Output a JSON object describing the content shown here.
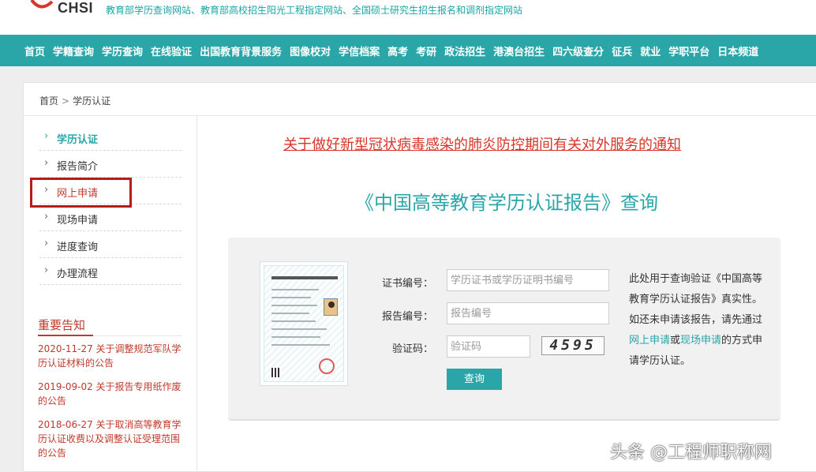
{
  "header": {
    "logo_text": "CHSI",
    "tagline": "教育部学历查询网站、教育部高校招生阳光工程指定网站、全国硕士研究生招生报名和调剂指定网站"
  },
  "nav": [
    "首页",
    "学籍查询",
    "学历查询",
    "在线验证",
    "出国教育背景服务",
    "图像校对",
    "学信档案",
    "高考",
    "考研",
    "政法招生",
    "港澳台招生",
    "四六级查分",
    "征兵",
    "就业",
    "学职平台",
    "日本频道"
  ],
  "breadcrumb": {
    "home": "首页",
    "sep": ">",
    "current": "学历认证"
  },
  "sidebar": {
    "items": [
      {
        "label": "学历认证"
      },
      {
        "label": "报告简介"
      },
      {
        "label": "网上申请"
      },
      {
        "label": "现场申请"
      },
      {
        "label": "进度查询"
      },
      {
        "label": "办理流程"
      }
    ],
    "notice_title": "重要告知",
    "notices": [
      "2020-11-27 关于调整规范军队学历认证材料的公告",
      "2019-09-02 关于报告专用纸作废的公告",
      "2018-06-27 关于取消高等教育学历认证收费以及调整认证受理范围的公告"
    ]
  },
  "main": {
    "headline": "关于做好新型冠状病毒感染的肺炎防控期间有关对外服务的通知",
    "title": "《中国高等教育学历认证报告》查询"
  },
  "form": {
    "cert_label": "证书编号：",
    "cert_placeholder": "学历证书或学历证明书编号",
    "report_label": "报告编号：",
    "report_placeholder": "报告编号",
    "captcha_label": "验证码：",
    "captcha_placeholder": "验证码",
    "captcha_value": "4595",
    "submit": "查询"
  },
  "help": {
    "p1": "此处用于查询验证《中国高等教育学历认证报告》真实性。如还未申请该报告，请先通过",
    "link1": "网上申请",
    "mid": "或",
    "link2": "现场申请",
    "p2": "的方式申请学历认证。"
  },
  "watermark": "头条 @工程师职称网",
  "colors": {
    "brand": "#2aa6a8",
    "alert": "#d9352a",
    "highlight_box": "#b71c1c"
  }
}
